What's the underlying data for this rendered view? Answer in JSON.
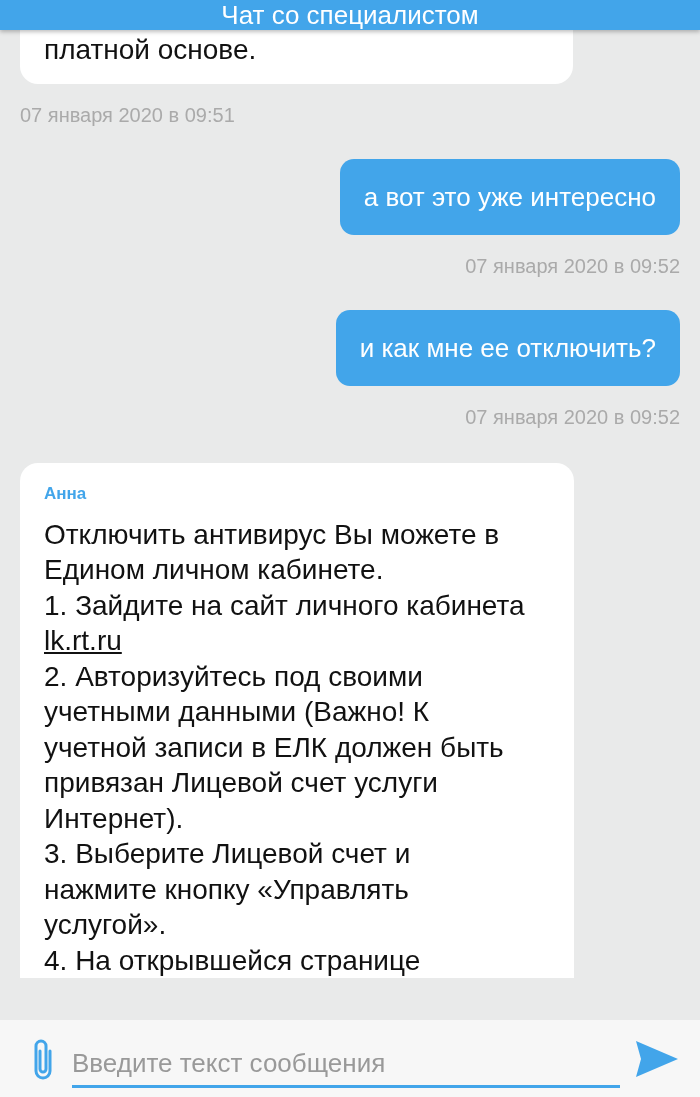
{
  "header": {
    "title": "Чат со специалистом"
  },
  "messages": [
    {
      "kind": "incoming",
      "paragraphs": [
        {
          "text": "платной основе."
        }
      ],
      "time": "07 января 2020 в 09:51"
    },
    {
      "kind": "outgoing",
      "paragraphs": [
        {
          "text": "а вот это уже интересно"
        }
      ],
      "time": "07 января 2020 в 09:52"
    },
    {
      "kind": "outgoing",
      "paragraphs": [
        {
          "text": "и как мне ее отключить?"
        }
      ],
      "time": "07 января 2020 в 09:52"
    },
    {
      "kind": "incoming",
      "author": "Анна",
      "paragraphs": [
        {
          "text": "Отключить антивирус Вы можете в Едином личном кабинете."
        },
        {
          "text": "1. Зайдите на сайт личного кабинета",
          "link": "lk.rt.ru"
        },
        {
          "text": "2. Авторизуйтесь под своими учетными данными (Важно! К учетной записи в ЕЛК должен быть привязан Лицевой счет услуги Интернет)."
        },
        {
          "text": "3. Выберите Лицевой счет и нажмите кнопку «Управлять услугой»."
        },
        {
          "text": "4. На открывшейся странице"
        }
      ]
    }
  ],
  "composer": {
    "placeholder": "Введите текст сообщения"
  }
}
